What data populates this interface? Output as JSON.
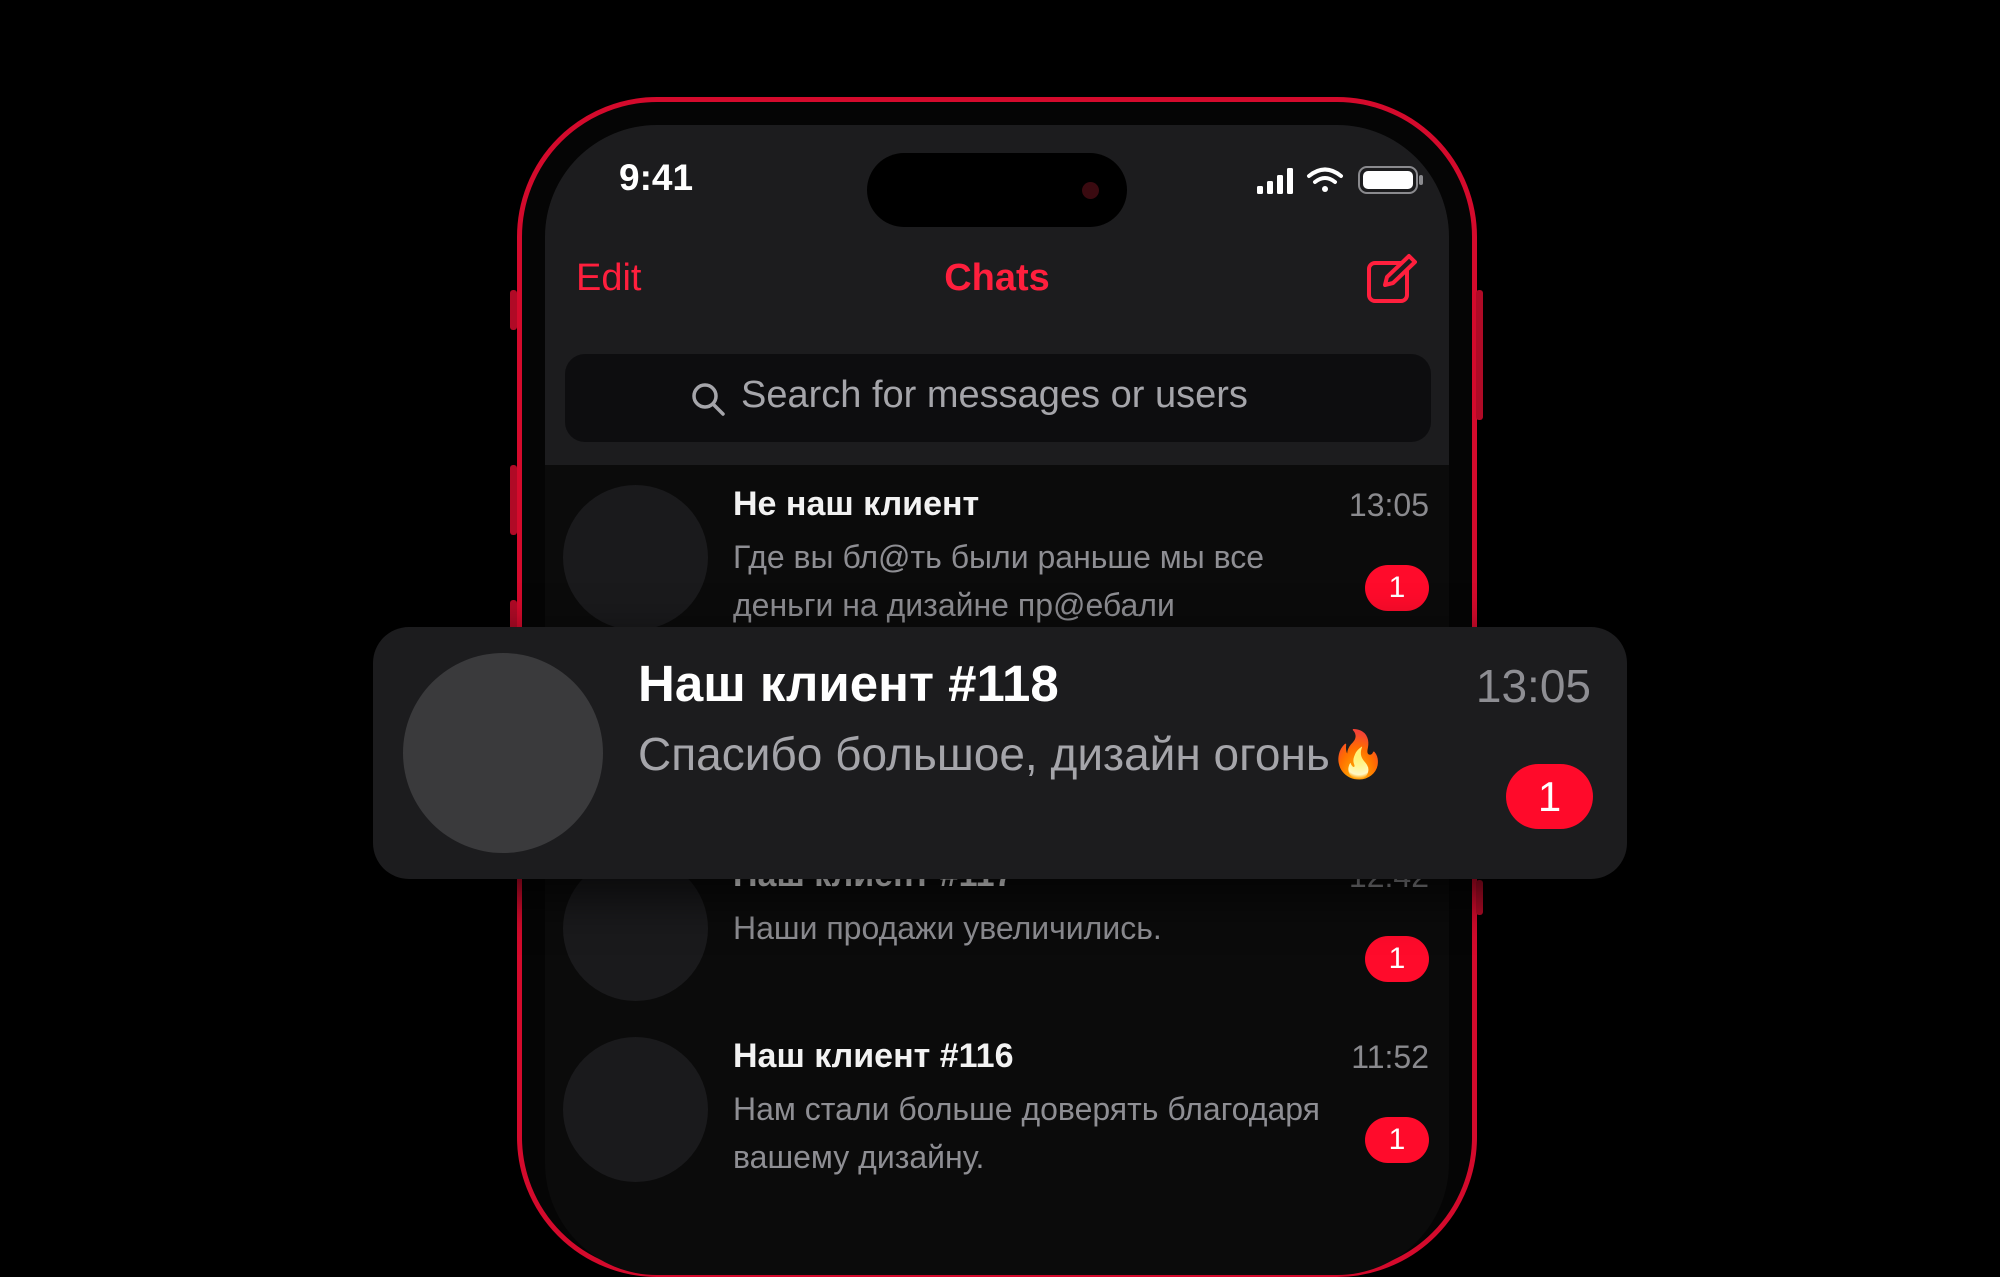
{
  "status_bar": {
    "time": "9:41"
  },
  "nav": {
    "edit_label": "Edit",
    "title": "Chats"
  },
  "search": {
    "placeholder": "Search for messages or users"
  },
  "chats": [
    {
      "name": "Не наш клиент",
      "time": "13:05",
      "message": "Где вы бл@ть были раньше мы все деньги на дизайне пр@ебали",
      "unread": "1"
    },
    {
      "name": "Наш клиент #117",
      "time": "12:42",
      "message": "Наши продажи увеличились.",
      "unread": "1"
    },
    {
      "name": "Наш клиент #116",
      "time": "11:52",
      "message": "Нам стали больше доверять благодаря вашему дизайну.",
      "unread": "1"
    }
  ],
  "featured_chat": {
    "name": "Наш клиент #118",
    "time": "13:05",
    "message": "Спасибо большое, дизайн огонь🔥",
    "unread": "1"
  },
  "colors": {
    "accent": "#ff1f3d",
    "badge": "#ff0b2b",
    "background": "#000000"
  }
}
